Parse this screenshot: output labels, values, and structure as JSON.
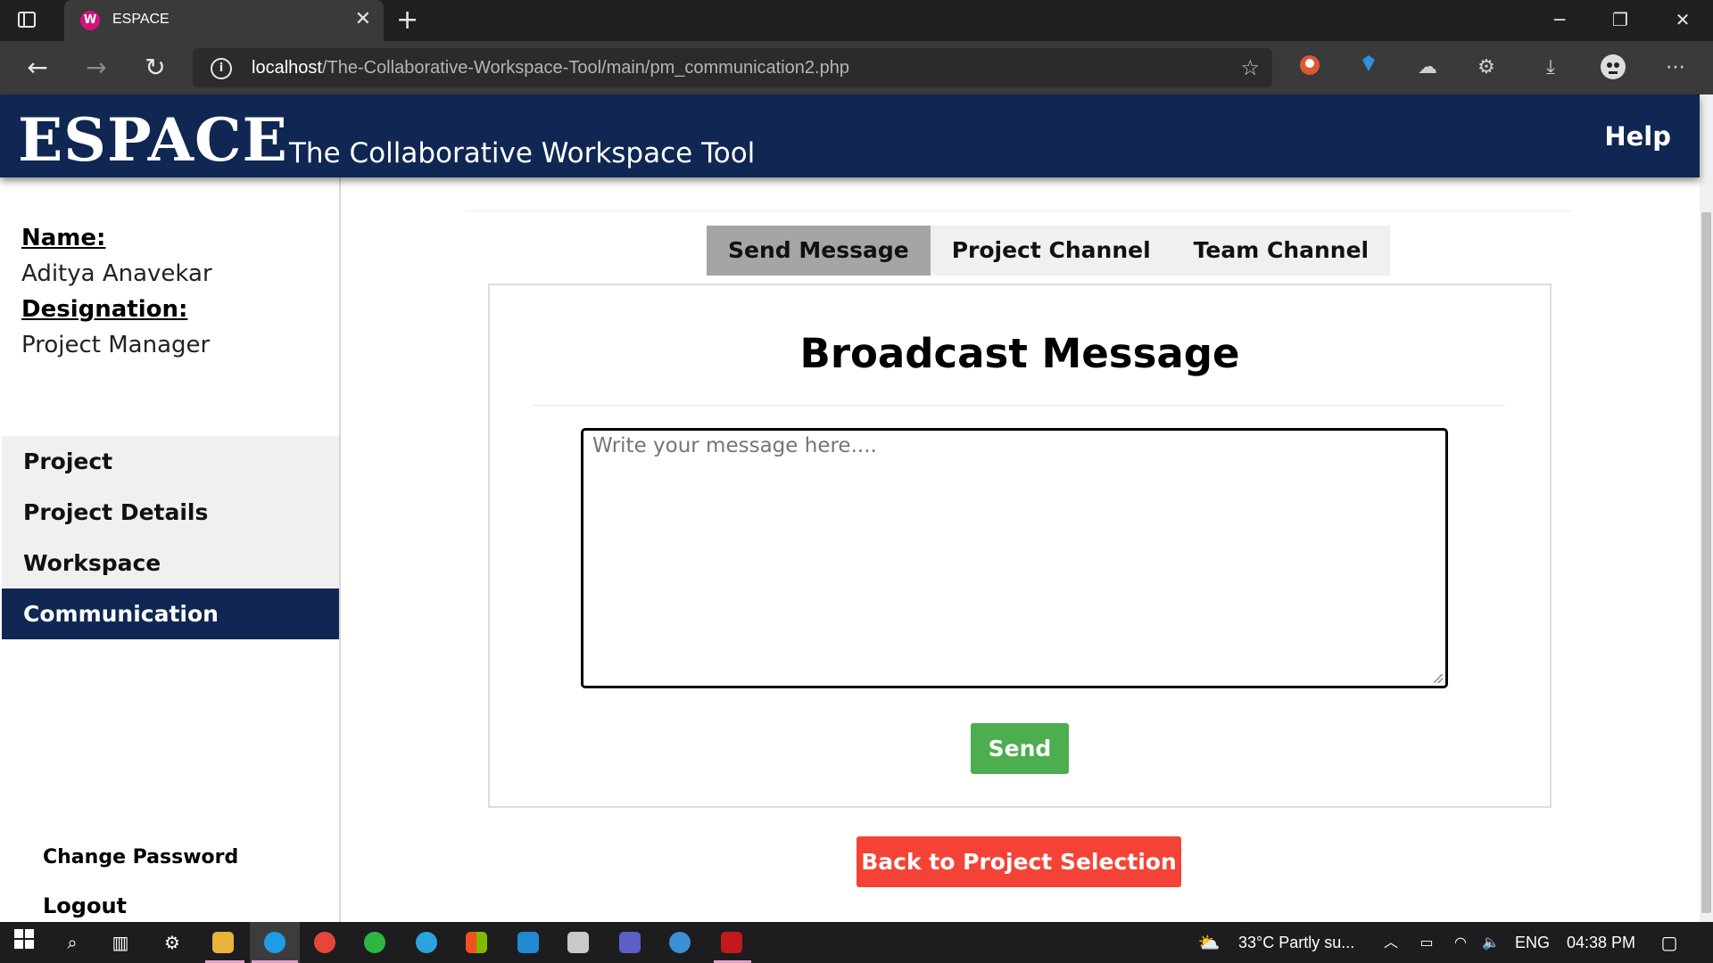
{
  "browser": {
    "tab_title": "ESPACE",
    "url_host": "localhost",
    "url_path": "/The-Collaborative-Workspace-Tool/main/pm_communication2.php"
  },
  "header": {
    "logo": "ESPACE",
    "tagline": "The Collaborative Workspace Tool",
    "help": "Help",
    "bg_color": "#0f2752"
  },
  "profile": {
    "name_label": "Name:",
    "name_value": "Aditya Anavekar",
    "designation_label": "Designation:",
    "designation_value": "Project Manager"
  },
  "sidebar": {
    "items": [
      {
        "label": "Project"
      },
      {
        "label": "Project Details"
      },
      {
        "label": "Workspace"
      },
      {
        "label": "Communication",
        "active": true
      }
    ],
    "change_password": "Change Password",
    "logout": "Logout"
  },
  "main": {
    "tabs": [
      {
        "label": "Send Message",
        "active": true
      },
      {
        "label": "Project Channel"
      },
      {
        "label": "Team Channel"
      }
    ],
    "card_title": "Broadcast Message",
    "message_placeholder": "Write your message here....",
    "send_label": "Send",
    "back_label": "Back to Project Selection",
    "send_color": "#4cae4f",
    "back_color": "#f44336"
  },
  "taskbar": {
    "weather": "33°C  Partly su...",
    "language": "ENG",
    "time": "04:38 PM"
  }
}
